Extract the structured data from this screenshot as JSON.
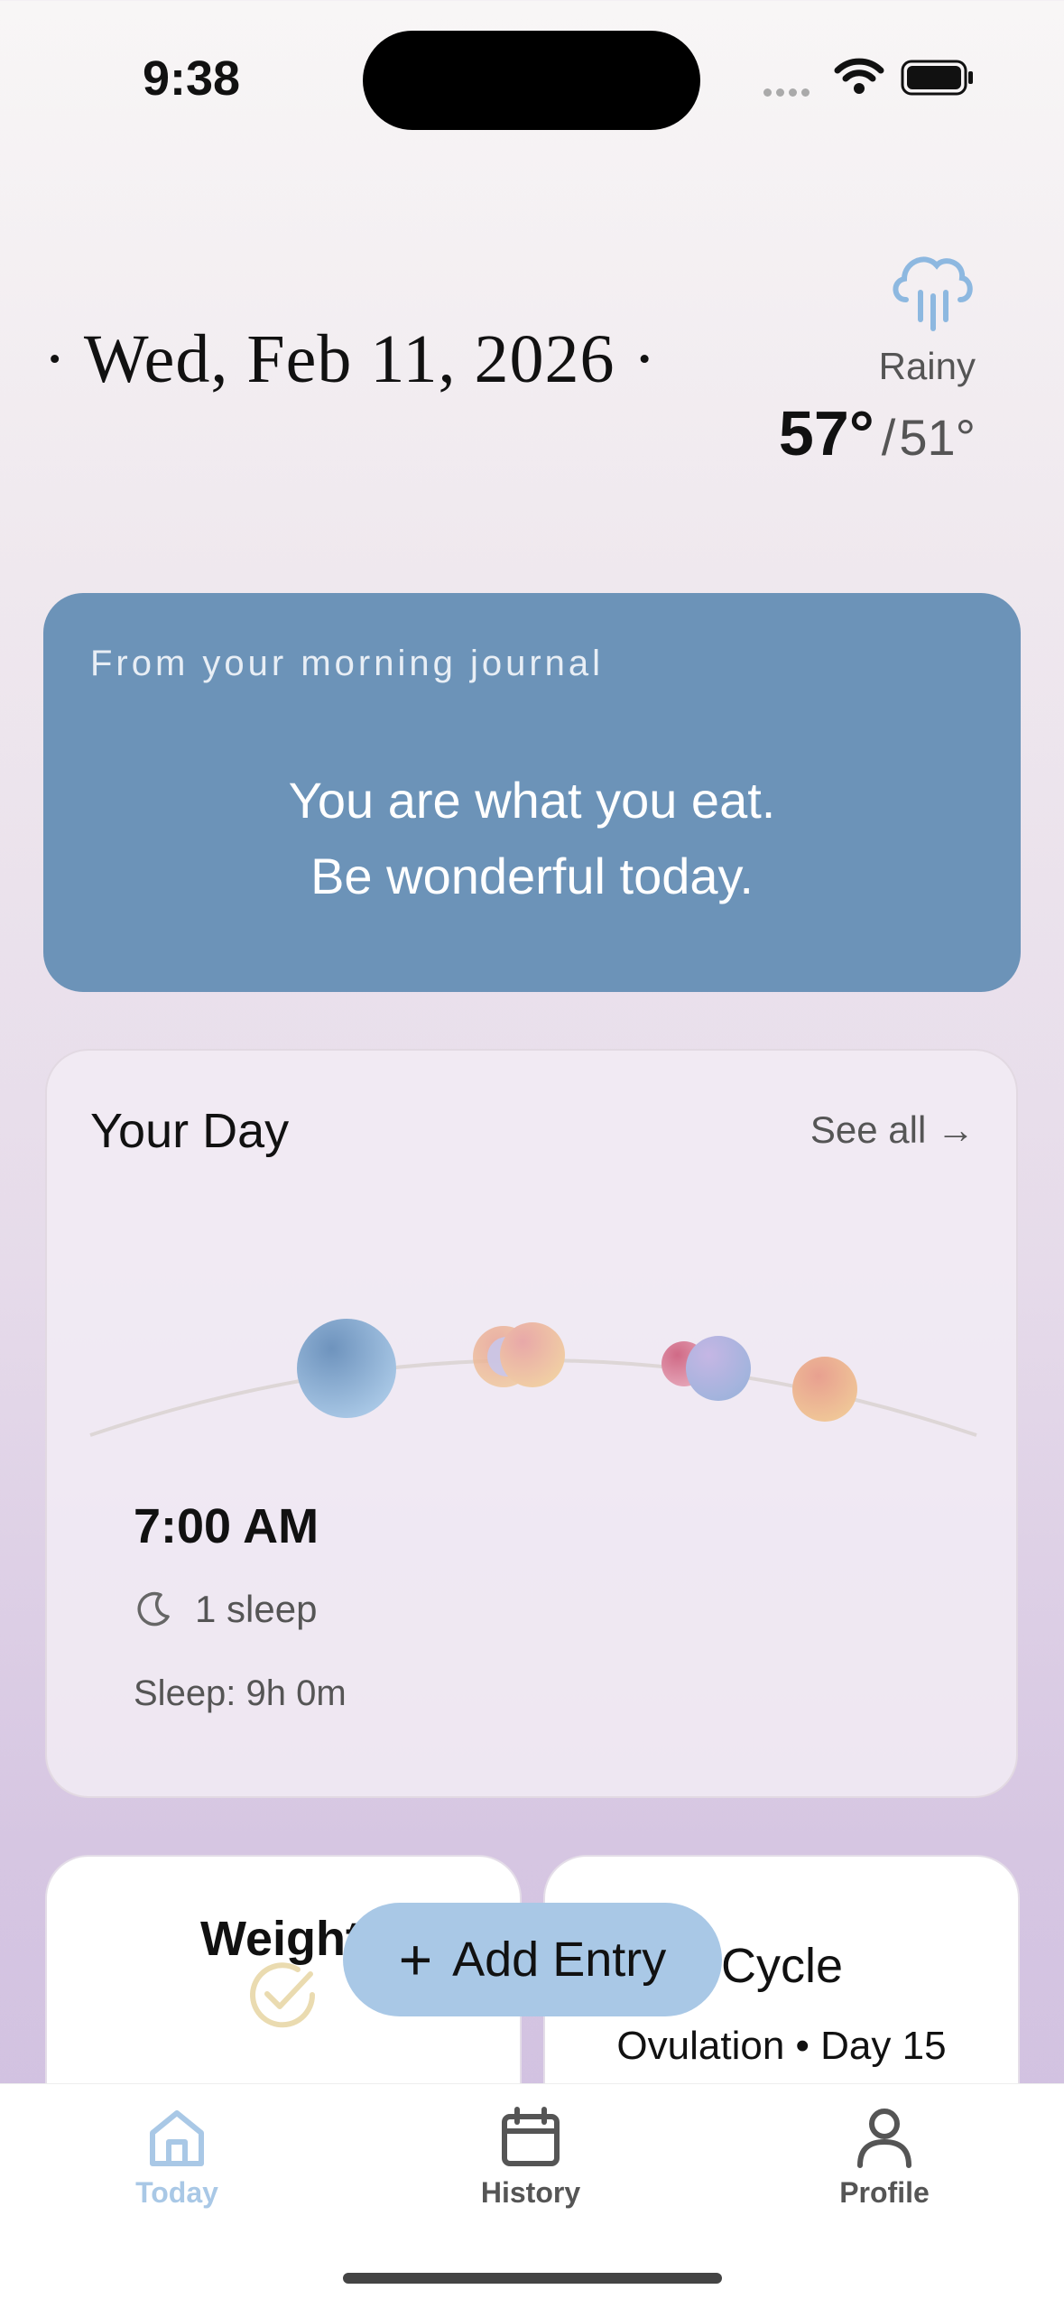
{
  "status_bar": {
    "time": "9:38"
  },
  "header": {
    "date": "· Wed, Feb 11, 2026 ·",
    "weather": {
      "icon": "rain-cloud-icon",
      "condition": "Rainy",
      "high": "57°",
      "separator": "/",
      "low": "51°"
    }
  },
  "journal": {
    "label": "From your morning journal",
    "quote_line1": "You are what you eat.",
    "quote_line2": "Be wonderful today."
  },
  "your_day": {
    "title": "Your Day",
    "see_all": "See all →",
    "selected_entry": {
      "time": "7:00 AM",
      "icon": "moon-icon",
      "summary": "1 sleep",
      "detail": "Sleep: 9h 0m"
    }
  },
  "cards": {
    "weight": {
      "title": "Weight",
      "icon": "check-circle-icon"
    },
    "cycle": {
      "title": "Cycle",
      "subtitle": "Ovulation • Day 15"
    }
  },
  "add_entry": {
    "label": "Add Entry"
  },
  "tabs": [
    {
      "label": "Today",
      "icon": "home-icon",
      "active": true
    },
    {
      "label": "History",
      "icon": "calendar-icon",
      "active": false
    },
    {
      "label": "Profile",
      "icon": "person-icon",
      "active": false
    }
  ],
  "colors": {
    "accent": "#a9c8e6",
    "journal_bg": "#6c93b8"
  }
}
